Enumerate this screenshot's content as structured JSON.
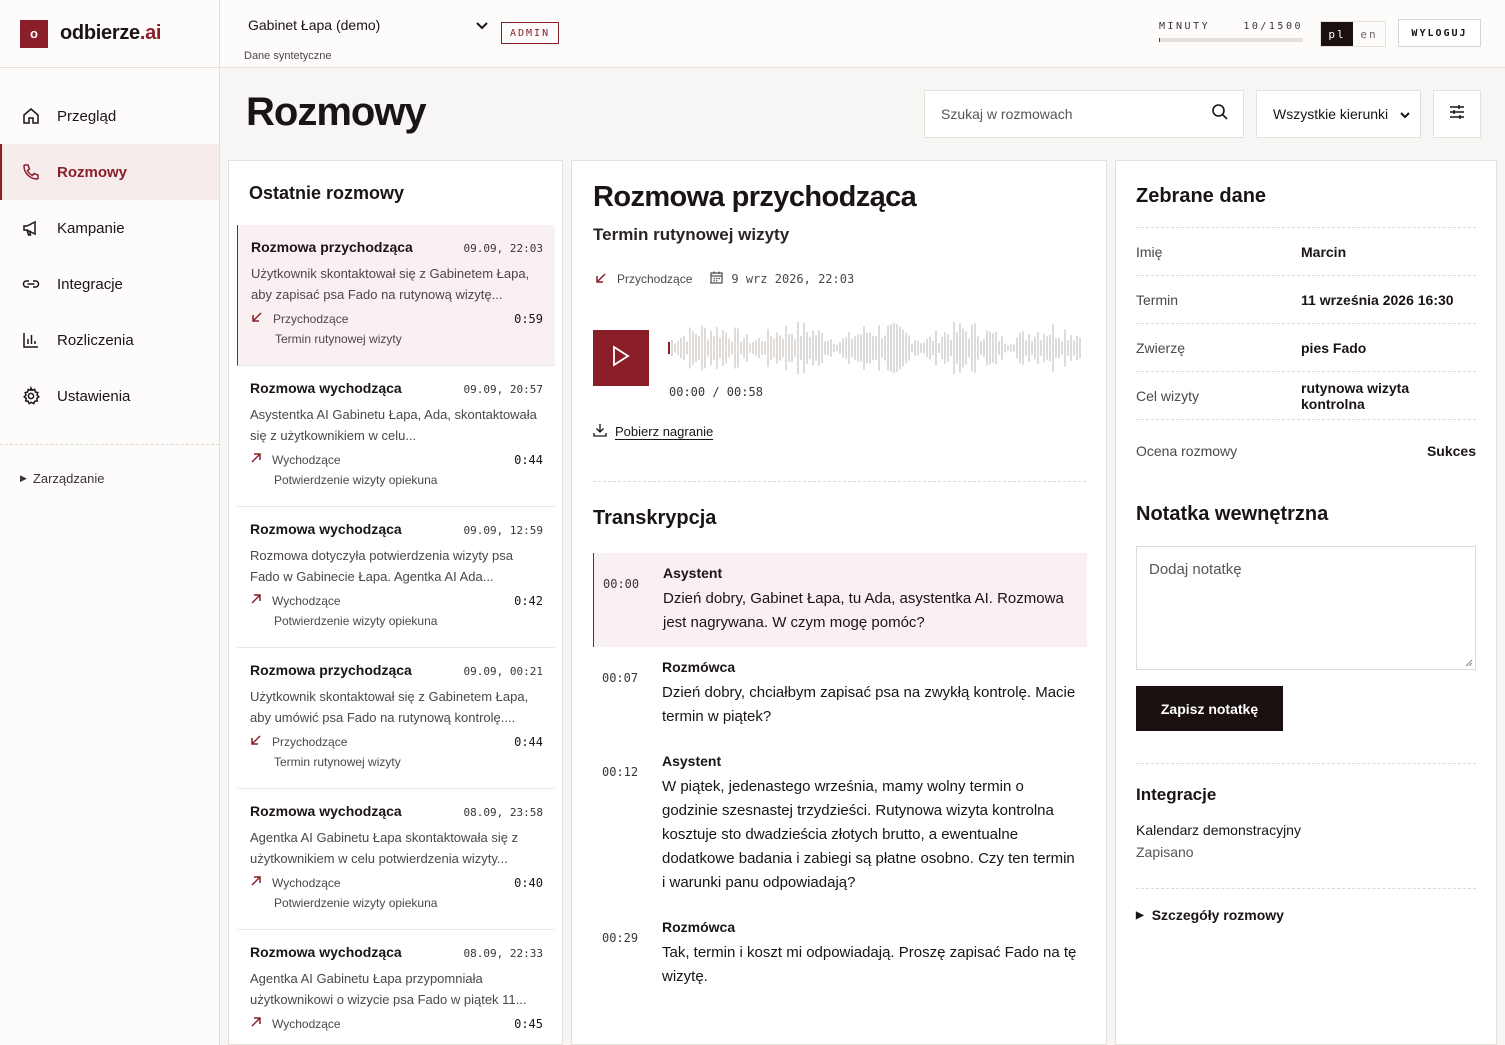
{
  "brand": {
    "mark": "o",
    "name": "odbierze",
    "suffix": ".ai"
  },
  "nav": {
    "items": [
      {
        "label": "Przegląd",
        "icon": "home-icon"
      },
      {
        "label": "Rozmowy",
        "icon": "phone-icon"
      },
      {
        "label": "Kampanie",
        "icon": "megaphone-icon"
      },
      {
        "label": "Integracje",
        "icon": "link-icon"
      },
      {
        "label": "Rozliczenia",
        "icon": "bar-chart-icon"
      },
      {
        "label": "Ustawienia",
        "icon": "gear-icon"
      }
    ],
    "active": "Rozmowy",
    "manage_label": "Zarządzanie"
  },
  "header": {
    "clinic": "Gabinet Łapa (demo)",
    "clinic_sub": "Dane syntetyczne",
    "role_badge": "ADMIN",
    "minutes_label": "MINUTY",
    "minutes_value": "10/1500",
    "minutes_used_fraction": 0.0067,
    "lang_active": "pl",
    "lang_other": "en",
    "logout_label": "WYLOGUJ"
  },
  "page": {
    "title": "Rozmowy",
    "search_placeholder": "Szukaj w rozmowach",
    "direction_filter": "Wszystkie kierunki"
  },
  "recent": {
    "title": "Ostatnie rozmowy",
    "calls": [
      {
        "title": "Rozmowa przychodząca",
        "time": "09.09, 22:03",
        "summary": "Użytkownik skontaktował się z Gabinetem Łapa, aby zapisać psa Fado na rutynową wizytę...",
        "direction": "Przychodzące",
        "dir": "in",
        "duration": "0:59",
        "purpose": "Termin rutynowej wizyty"
      },
      {
        "title": "Rozmowa wychodząca",
        "time": "09.09, 20:57",
        "summary": "Asystentka AI Gabinetu Łapa, Ada, skontaktowała się z użytkownikiem w celu...",
        "direction": "Wychodzące",
        "dir": "out",
        "duration": "0:44",
        "purpose": "Potwierdzenie wizyty opiekuna"
      },
      {
        "title": "Rozmowa wychodząca",
        "time": "09.09, 12:59",
        "summary": "Rozmowa dotyczyła potwierdzenia wizyty psa Fado w Gabinecie Łapa. Agentka AI Ada...",
        "direction": "Wychodzące",
        "dir": "out",
        "duration": "0:42",
        "purpose": "Potwierdzenie wizyty opiekuna"
      },
      {
        "title": "Rozmowa przychodząca",
        "time": "09.09, 00:21",
        "summary": "Użytkownik skontaktował się z Gabinetem Łapa, aby umówić psa Fado na rutynową kontrolę....",
        "direction": "Przychodzące",
        "dir": "in",
        "duration": "0:44",
        "purpose": "Termin rutynowej wizyty"
      },
      {
        "title": "Rozmowa wychodząca",
        "time": "08.09, 23:58",
        "summary": "Agentka AI Gabinetu Łapa skontaktowała się z użytkownikiem w celu potwierdzenia wizyty...",
        "direction": "Wychodzące",
        "dir": "out",
        "duration": "0:40",
        "purpose": "Potwierdzenie wizyty opiekuna"
      },
      {
        "title": "Rozmowa wychodząca",
        "time": "08.09, 22:33",
        "summary": "Agentka AI Gabinetu Łapa przypomniała użytkownikowi o wizycie psa Fado w piątek 11...",
        "direction": "Wychodzące",
        "dir": "out",
        "duration": "0:45",
        "purpose": ""
      }
    ]
  },
  "detail": {
    "title": "Rozmowa przychodząca",
    "subtitle": "Termin rutynowej wizyty",
    "direction": "Przychodzące",
    "date": "9 wrz 2026, 22:03",
    "timecode": "00:00 / 00:58",
    "download_label": "Pobierz nagranie",
    "transcript_title": "Transkrypcja",
    "transcript": [
      {
        "ts": "00:00",
        "speaker": "Asystent",
        "text": "Dzień dobry, Gabinet Łapa, tu Ada, asystentka AI. Rozmowa jest nagrywana. W czym mogę pomóc?"
      },
      {
        "ts": "00:07",
        "speaker": "Rozmówca",
        "text": "Dzień dobry, chciałbym zapisać psa na zwykłą kontrolę. Macie termin w piątek?"
      },
      {
        "ts": "00:12",
        "speaker": "Asystent",
        "text": "W piątek, jedenastego września, mamy wolny termin o godzinie szesnastej trzydzieści. Rutynowa wizyta kontrolna kosztuje sto dwadzieścia złotych brutto, a ewentualne dodatkowe badania i zabiegi są płatne osobno. Czy ten termin i warunki panu odpowiadają?"
      },
      {
        "ts": "00:29",
        "speaker": "Rozmówca",
        "text": "Tak, termin i koszt mi odpowiadają. Proszę zapisać Fado na tę wizytę."
      }
    ]
  },
  "collected": {
    "title": "Zebrane dane",
    "fields": [
      {
        "label": "Imię",
        "value": "Marcin"
      },
      {
        "label": "Termin",
        "value": "11 września 2026 16:30"
      },
      {
        "label": "Zwierzę",
        "value": "pies Fado"
      },
      {
        "label": "Cel wizyty",
        "value": "rutynowa wizyta kontrolna"
      }
    ],
    "rating_label": "Ocena rozmowy",
    "rating_value": "Sukces",
    "note_title": "Notatka wewnętrzna",
    "note_placeholder": "Dodaj notatkę",
    "save_label": "Zapisz notatkę",
    "integrations_title": "Integracje",
    "integration_name": "Kalendarz demonstracyjny",
    "integration_status": "Zapisano",
    "details_label": "Szczegóły rozmowy"
  },
  "colors": {
    "accent": "#8a1f2a",
    "dark": "#1a1010"
  }
}
